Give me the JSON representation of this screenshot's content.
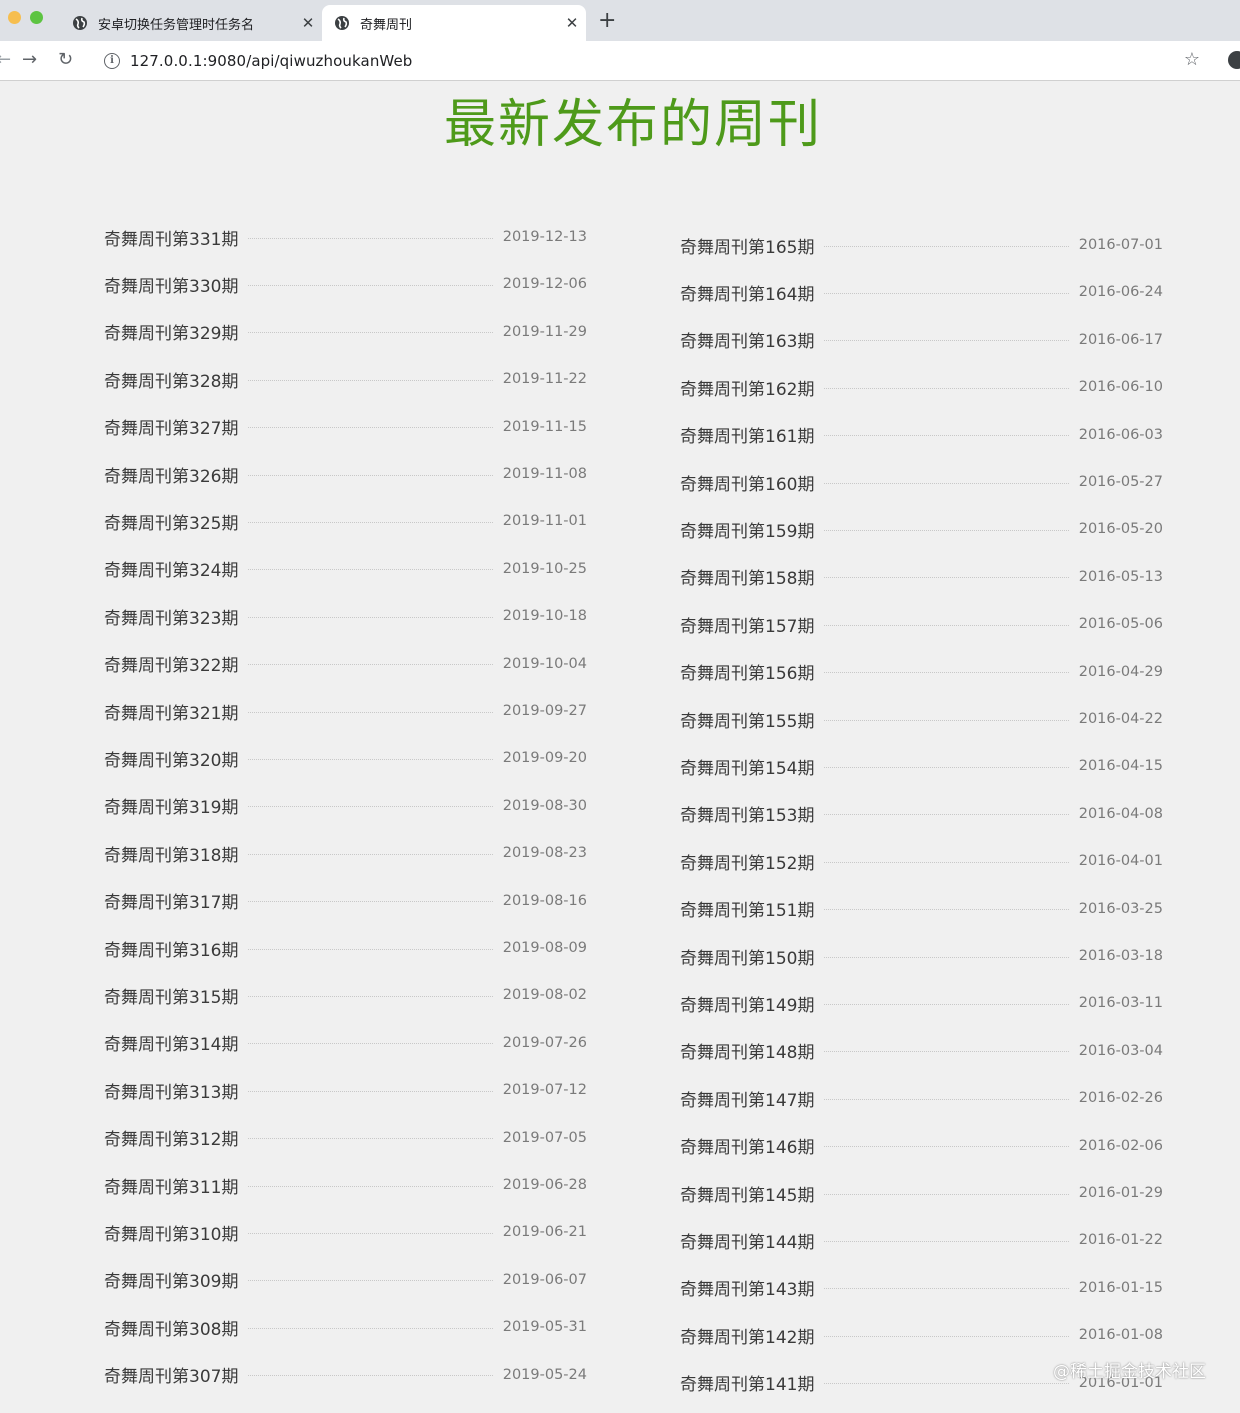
{
  "browser": {
    "tabs": [
      {
        "title": "安卓切换任务管理时任务名",
        "active": false
      },
      {
        "title": "奇舞周刊",
        "active": true
      }
    ],
    "url": "127.0.0.1:9080/api/qiwuzhoukanWeb"
  },
  "page": {
    "title": "最新发布的周刊",
    "title_color": "#4e9a1a"
  },
  "left_column": [
    {
      "name": "奇舞周刊第331期",
      "date": "2019-12-13"
    },
    {
      "name": "奇舞周刊第330期",
      "date": "2019-12-06"
    },
    {
      "name": "奇舞周刊第329期",
      "date": "2019-11-29"
    },
    {
      "name": "奇舞周刊第328期",
      "date": "2019-11-22"
    },
    {
      "name": "奇舞周刊第327期",
      "date": "2019-11-15"
    },
    {
      "name": "奇舞周刊第326期",
      "date": "2019-11-08"
    },
    {
      "name": "奇舞周刊第325期",
      "date": "2019-11-01"
    },
    {
      "name": "奇舞周刊第324期",
      "date": "2019-10-25"
    },
    {
      "name": "奇舞周刊第323期",
      "date": "2019-10-18"
    },
    {
      "name": "奇舞周刊第322期",
      "date": "2019-10-04"
    },
    {
      "name": "奇舞周刊第321期",
      "date": "2019-09-27"
    },
    {
      "name": "奇舞周刊第320期",
      "date": "2019-09-20"
    },
    {
      "name": "奇舞周刊第319期",
      "date": "2019-08-30"
    },
    {
      "name": "奇舞周刊第318期",
      "date": "2019-08-23"
    },
    {
      "name": "奇舞周刊第317期",
      "date": "2019-08-16"
    },
    {
      "name": "奇舞周刊第316期",
      "date": "2019-08-09"
    },
    {
      "name": "奇舞周刊第315期",
      "date": "2019-08-02"
    },
    {
      "name": "奇舞周刊第314期",
      "date": "2019-07-26"
    },
    {
      "name": "奇舞周刊第313期",
      "date": "2019-07-12"
    },
    {
      "name": "奇舞周刊第312期",
      "date": "2019-07-05"
    },
    {
      "name": "奇舞周刊第311期",
      "date": "2019-06-28"
    },
    {
      "name": "奇舞周刊第310期",
      "date": "2019-06-21"
    },
    {
      "name": "奇舞周刊第309期",
      "date": "2019-06-07"
    },
    {
      "name": "奇舞周刊第308期",
      "date": "2019-05-31"
    },
    {
      "name": "奇舞周刊第307期",
      "date": "2019-05-24"
    }
  ],
  "right_column": [
    {
      "name": "奇舞周刊第165期",
      "date": "2016-07-01"
    },
    {
      "name": "奇舞周刊第164期",
      "date": "2016-06-24"
    },
    {
      "name": "奇舞周刊第163期",
      "date": "2016-06-17"
    },
    {
      "name": "奇舞周刊第162期",
      "date": "2016-06-10"
    },
    {
      "name": "奇舞周刊第161期",
      "date": "2016-06-03"
    },
    {
      "name": "奇舞周刊第160期",
      "date": "2016-05-27"
    },
    {
      "name": "奇舞周刊第159期",
      "date": "2016-05-20"
    },
    {
      "name": "奇舞周刊第158期",
      "date": "2016-05-13"
    },
    {
      "name": "奇舞周刊第157期",
      "date": "2016-05-06"
    },
    {
      "name": "奇舞周刊第156期",
      "date": "2016-04-29"
    },
    {
      "name": "奇舞周刊第155期",
      "date": "2016-04-22"
    },
    {
      "name": "奇舞周刊第154期",
      "date": "2016-04-15"
    },
    {
      "name": "奇舞周刊第153期",
      "date": "2016-04-08"
    },
    {
      "name": "奇舞周刊第152期",
      "date": "2016-04-01"
    },
    {
      "name": "奇舞周刊第151期",
      "date": "2016-03-25"
    },
    {
      "name": "奇舞周刊第150期",
      "date": "2016-03-18"
    },
    {
      "name": "奇舞周刊第149期",
      "date": "2016-03-11"
    },
    {
      "name": "奇舞周刊第148期",
      "date": "2016-03-04"
    },
    {
      "name": "奇舞周刊第147期",
      "date": "2016-02-26"
    },
    {
      "name": "奇舞周刊第146期",
      "date": "2016-02-06"
    },
    {
      "name": "奇舞周刊第145期",
      "date": "2016-01-29"
    },
    {
      "name": "奇舞周刊第144期",
      "date": "2016-01-22"
    },
    {
      "name": "奇舞周刊第143期",
      "date": "2016-01-15"
    },
    {
      "name": "奇舞周刊第142期",
      "date": "2016-01-08"
    },
    {
      "name": "奇舞周刊第141期",
      "date": "2016-01-01"
    }
  ],
  "watermark": "@稀土掘金技术社区",
  "icons": {
    "tab_favicon": "globe-icon",
    "tab_close": "close-icon",
    "new_tab": "plus-icon",
    "back": "arrow-left-icon",
    "forward": "arrow-right-icon",
    "reload": "reload-icon",
    "site_info": "info-icon",
    "bookmark": "star-icon",
    "profile": "profile-icon"
  }
}
